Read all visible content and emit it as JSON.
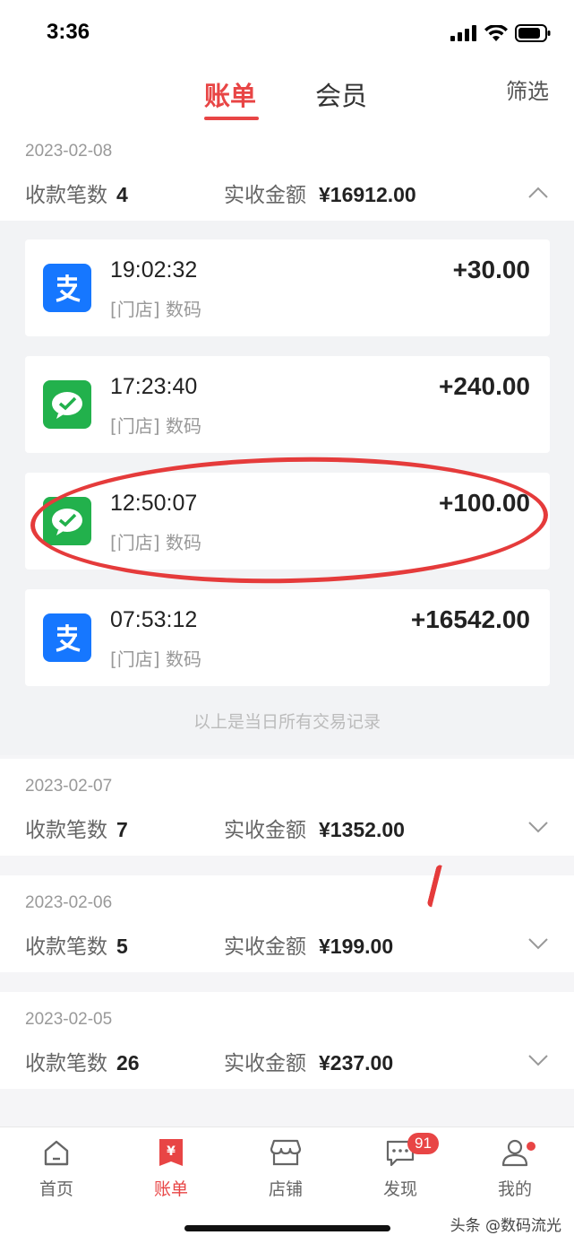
{
  "status": {
    "time": "3:36"
  },
  "nav": {
    "tab_bill": "账单",
    "tab_member": "会员",
    "filter": "筛选"
  },
  "days": [
    {
      "date": "2023-02-08",
      "count_label": "收款笔数",
      "count": "4",
      "amount_label": "实收金额",
      "amount": "¥16912.00",
      "expanded": true
    },
    {
      "date": "2023-02-07",
      "count_label": "收款笔数",
      "count": "7",
      "amount_label": "实收金额",
      "amount": "¥1352.00",
      "expanded": false
    },
    {
      "date": "2023-02-06",
      "count_label": "收款笔数",
      "count": "5",
      "amount_label": "实收金额",
      "amount": "¥199.00",
      "expanded": false
    },
    {
      "date": "2023-02-05",
      "count_label": "收款笔数",
      "count": "26",
      "amount_label": "实收金额",
      "amount": "¥237.00",
      "expanded": false
    }
  ],
  "transactions": [
    {
      "method_icon": "alipay-icon",
      "time": "19:02:32",
      "store": "[门店]   数码",
      "amount": "+30.00"
    },
    {
      "method_icon": "wechat-pay-icon",
      "time": "17:23:40",
      "store": "[门店]   数码",
      "amount": "+240.00"
    },
    {
      "method_icon": "wechat-pay-icon",
      "time": "12:50:07",
      "store": "[门店]   数码",
      "amount": "+100.00"
    },
    {
      "method_icon": "alipay-icon",
      "time": "07:53:12",
      "store": "[门店]   数码",
      "amount": "+16542.00"
    }
  ],
  "end_note": "以上是当日所有交易记录",
  "tabbar": {
    "home": "首页",
    "bill": "账单",
    "shop": "店铺",
    "discover": "发现",
    "mine": "我的",
    "discover_badge": "91"
  },
  "watermark": "头条 @数码流光",
  "colors": {
    "accent": "#e84545",
    "alipay": "#1677ff",
    "wechat": "#22b14c"
  }
}
